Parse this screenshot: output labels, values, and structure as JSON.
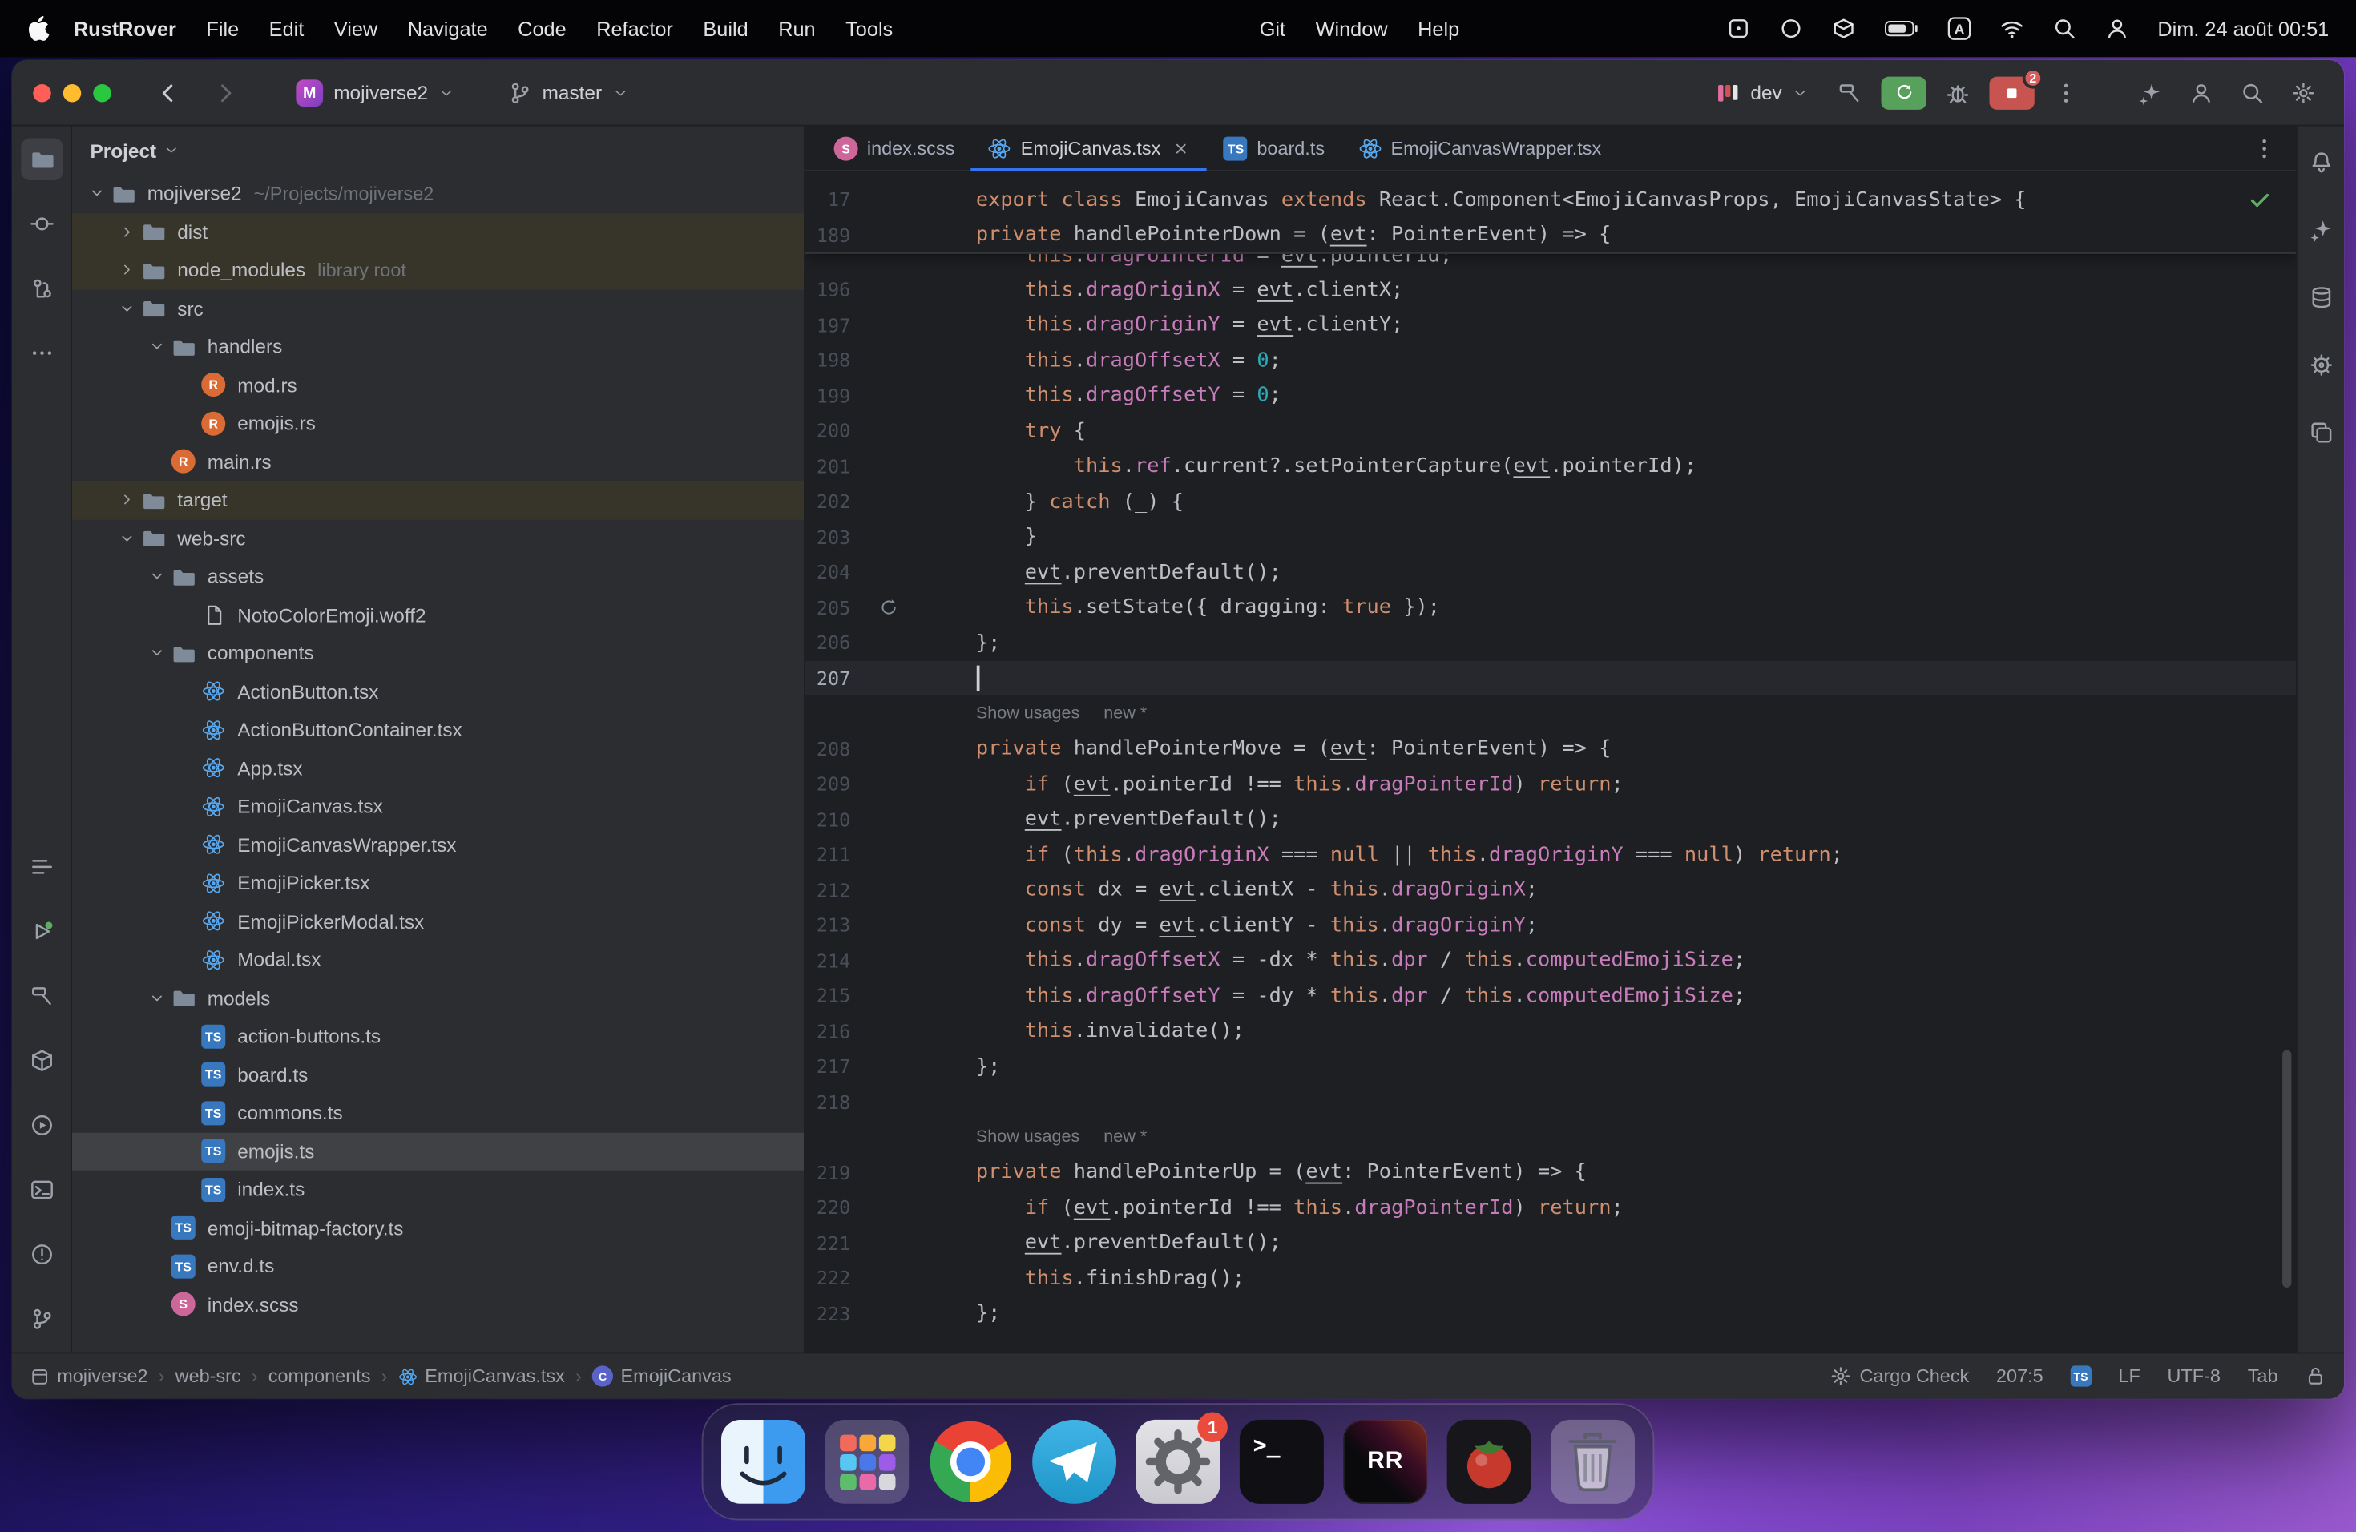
{
  "colors": {
    "accent": "#3574F0",
    "keyword": "#CF8E6D",
    "field": "#C77DBB",
    "number": "#2AACB8",
    "text": "#BCBEC4",
    "excluded_bg": "#37352A",
    "run_green": "#57A15D",
    "stop_red": "#C75450"
  },
  "menubar": {
    "menus": [
      "RustRover",
      "File",
      "Edit",
      "View",
      "Navigate",
      "Code",
      "Refactor",
      "Build",
      "Run",
      "Tools"
    ],
    "menus2": [
      "Git",
      "Window",
      "Help"
    ],
    "status_icons": [
      "screen-box",
      "recording",
      "dropbox",
      "battery",
      "input-source",
      "wifi",
      "spotlight",
      "user-switch"
    ],
    "input_source": "A",
    "clock": "Dim. 24 août 00:51"
  },
  "titlebar": {
    "project_name": "mojiverse2",
    "project_initial": "M",
    "branch": "master",
    "run_config": "dev",
    "stop_badge": "2"
  },
  "left_strip": {
    "top": [
      "project",
      "commit",
      "pull-requests",
      "more"
    ],
    "bottom": [
      "structure",
      "run",
      "build",
      "packages",
      "services",
      "terminal",
      "problems",
      "version-control"
    ]
  },
  "right_strip": [
    "notifications",
    "ai-assistant",
    "database",
    "cargo",
    "dependencies"
  ],
  "project_panel": {
    "header": "Project",
    "tree": [
      {
        "l": "mojiverse2",
        "s": "~/Projects/mojiverse2",
        "i": "folder",
        "d": 0,
        "c": "open"
      },
      {
        "l": "dist",
        "i": "folder",
        "d": 1,
        "c": "closed",
        "m": "excluded"
      },
      {
        "l": "node_modules",
        "s": "library root",
        "i": "folder",
        "d": 1,
        "c": "closed",
        "m": "excluded"
      },
      {
        "l": "src",
        "i": "folder",
        "d": 1,
        "c": "open"
      },
      {
        "l": "handlers",
        "i": "folder",
        "d": 2,
        "c": "open"
      },
      {
        "l": "mod.rs",
        "i": "rust",
        "d": 3
      },
      {
        "l": "emojis.rs",
        "i": "rust",
        "d": 3
      },
      {
        "l": "main.rs",
        "i": "rust",
        "d": 2
      },
      {
        "l": "target",
        "i": "folder",
        "d": 1,
        "c": "closed",
        "m": "excluded"
      },
      {
        "l": "web-src",
        "i": "folder",
        "d": 1,
        "c": "open"
      },
      {
        "l": "assets",
        "i": "folder",
        "d": 2,
        "c": "open"
      },
      {
        "l": "NotoColorEmoji.woff2",
        "i": "file",
        "d": 3
      },
      {
        "l": "components",
        "i": "folder",
        "d": 2,
        "c": "open"
      },
      {
        "l": "ActionButton.tsx",
        "i": "react",
        "d": 3
      },
      {
        "l": "ActionButtonContainer.tsx",
        "i": "react",
        "d": 3
      },
      {
        "l": "App.tsx",
        "i": "react",
        "d": 3
      },
      {
        "l": "EmojiCanvas.tsx",
        "i": "react",
        "d": 3
      },
      {
        "l": "EmojiCanvasWrapper.tsx",
        "i": "react",
        "d": 3
      },
      {
        "l": "EmojiPicker.tsx",
        "i": "react",
        "d": 3
      },
      {
        "l": "EmojiPickerModal.tsx",
        "i": "react",
        "d": 3
      },
      {
        "l": "Modal.tsx",
        "i": "react",
        "d": 3
      },
      {
        "l": "models",
        "i": "folder",
        "d": 2,
        "c": "open"
      },
      {
        "l": "action-buttons.ts",
        "i": "ts",
        "d": 3
      },
      {
        "l": "board.ts",
        "i": "ts",
        "d": 3
      },
      {
        "l": "commons.ts",
        "i": "ts",
        "d": 3
      },
      {
        "l": "emojis.ts",
        "i": "ts",
        "d": 3,
        "m": "selected"
      },
      {
        "l": "index.ts",
        "i": "ts",
        "d": 3
      },
      {
        "l": "emoji-bitmap-factory.ts",
        "i": "ts",
        "d": 2
      },
      {
        "l": "env.d.ts",
        "i": "ts",
        "d": 2
      },
      {
        "l": "index.scss",
        "i": "scss",
        "d": 2
      }
    ]
  },
  "tabs": [
    {
      "label": "index.scss",
      "icon": "scss"
    },
    {
      "label": "EmojiCanvas.tsx",
      "icon": "react",
      "active": true,
      "close": true
    },
    {
      "label": "board.ts",
      "icon": "ts"
    },
    {
      "label": "EmojiCanvasWrapper.tsx",
      "icon": "react"
    }
  ],
  "editor": {
    "hints": {
      "usages": "Show usages",
      "new": "new *"
    },
    "sticky_lines": [
      {
        "n": "17",
        "ind": 0,
        "parts": [
          [
            "export ",
            "k"
          ],
          [
            "class ",
            "k"
          ],
          [
            "EmojiCanvas ",
            "d"
          ],
          [
            "extends ",
            "k"
          ],
          [
            "React.Component<EmojiCanvasProps, EmojiCanvasState> {",
            "d"
          ]
        ]
      },
      {
        "n": "189",
        "ind": 4,
        "parts": [
          [
            "private ",
            "k"
          ],
          [
            "handlePointerDown = (",
            "d"
          ],
          [
            "evt",
            "u"
          ],
          [
            ": PointerEvent) => {",
            "d"
          ]
        ]
      }
    ],
    "lines": [
      {
        "clip": true,
        "ind": 8,
        "parts": [
          [
            "this",
            "k"
          ],
          [
            ".",
            "d"
          ],
          [
            "dragPointerId",
            "f"
          ],
          [
            " = ",
            "d"
          ],
          [
            "evt",
            "u"
          ],
          [
            ".pointerId;",
            "d"
          ]
        ]
      },
      {
        "n": "196",
        "ind": 8,
        "parts": [
          [
            "this",
            "k"
          ],
          [
            ".",
            "d"
          ],
          [
            "dragOriginX",
            "f"
          ],
          [
            " = ",
            "d"
          ],
          [
            "evt",
            "u"
          ],
          [
            ".clientX;",
            "d"
          ]
        ]
      },
      {
        "n": "197",
        "ind": 8,
        "parts": [
          [
            "this",
            "k"
          ],
          [
            ".",
            "d"
          ],
          [
            "dragOriginY",
            "f"
          ],
          [
            " = ",
            "d"
          ],
          [
            "evt",
            "u"
          ],
          [
            ".clientY;",
            "d"
          ]
        ]
      },
      {
        "n": "198",
        "ind": 8,
        "parts": [
          [
            "this",
            "k"
          ],
          [
            ".",
            "d"
          ],
          [
            "dragOffsetX",
            "f"
          ],
          [
            " = ",
            "d"
          ],
          [
            "0",
            "n"
          ],
          [
            ";",
            "d"
          ]
        ]
      },
      {
        "n": "199",
        "ind": 8,
        "parts": [
          [
            "this",
            "k"
          ],
          [
            ".",
            "d"
          ],
          [
            "dragOffsetY",
            "f"
          ],
          [
            " = ",
            "d"
          ],
          [
            "0",
            "n"
          ],
          [
            ";",
            "d"
          ]
        ]
      },
      {
        "n": "200",
        "ind": 8,
        "parts": [
          [
            "try",
            "k"
          ],
          [
            " {",
            "d"
          ]
        ]
      },
      {
        "n": "201",
        "ind": 12,
        "parts": [
          [
            "this",
            "k"
          ],
          [
            ".",
            "d"
          ],
          [
            "ref",
            "f"
          ],
          [
            ".current?.setPointerCapture(",
            "d"
          ],
          [
            "evt",
            "u"
          ],
          [
            ".pointerId);",
            "d"
          ]
        ]
      },
      {
        "n": "202",
        "ind": 8,
        "parts": [
          [
            "} ",
            "d"
          ],
          [
            "catch",
            "k"
          ],
          [
            " (_) {",
            "d"
          ]
        ]
      },
      {
        "n": "203",
        "ind": 8,
        "parts": [
          [
            "}",
            "d"
          ]
        ]
      },
      {
        "n": "204",
        "ind": 8,
        "parts": [
          [
            "evt",
            "u"
          ],
          [
            ".preventDefault();",
            "d"
          ]
        ]
      },
      {
        "n": "205",
        "ind": 8,
        "gutter_icon": "recompile",
        "parts": [
          [
            "this",
            "k"
          ],
          [
            ".setState({ dragging: ",
            "d"
          ],
          [
            "true",
            "k"
          ],
          [
            " });",
            "d"
          ]
        ]
      },
      {
        "n": "206",
        "ind": 4,
        "parts": [
          [
            "};",
            "d"
          ]
        ]
      },
      {
        "n": "207",
        "ind": 4,
        "caret": true,
        "parts": []
      },
      {
        "hint": true
      },
      {
        "n": "208",
        "ind": 4,
        "parts": [
          [
            "private ",
            "k"
          ],
          [
            "handlePointerMove = (",
            "d"
          ],
          [
            "evt",
            "u"
          ],
          [
            ": PointerEvent) => {",
            "d"
          ]
        ]
      },
      {
        "n": "209",
        "ind": 8,
        "parts": [
          [
            "if",
            "k"
          ],
          [
            " (",
            "d"
          ],
          [
            "evt",
            "u"
          ],
          [
            ".pointerId !== ",
            "d"
          ],
          [
            "this",
            "k"
          ],
          [
            ".",
            "d"
          ],
          [
            "dragPointerId",
            "f"
          ],
          [
            ") ",
            "d"
          ],
          [
            "return",
            "k"
          ],
          [
            ";",
            "d"
          ]
        ]
      },
      {
        "n": "210",
        "ind": 8,
        "parts": [
          [
            "evt",
            "u"
          ],
          [
            ".preventDefault();",
            "d"
          ]
        ]
      },
      {
        "n": "211",
        "ind": 8,
        "parts": [
          [
            "if",
            "k"
          ],
          [
            " (",
            "d"
          ],
          [
            "this",
            "k"
          ],
          [
            ".",
            "d"
          ],
          [
            "dragOriginX",
            "f"
          ],
          [
            " === ",
            "d"
          ],
          [
            "null",
            "k"
          ],
          [
            " || ",
            "d"
          ],
          [
            "this",
            "k"
          ],
          [
            ".",
            "d"
          ],
          [
            "dragOriginY",
            "f"
          ],
          [
            " === ",
            "d"
          ],
          [
            "null",
            "k"
          ],
          [
            ") ",
            "d"
          ],
          [
            "return",
            "k"
          ],
          [
            ";",
            "d"
          ]
        ]
      },
      {
        "n": "212",
        "ind": 8,
        "parts": [
          [
            "const",
            "k"
          ],
          [
            " dx = ",
            "d"
          ],
          [
            "evt",
            "u"
          ],
          [
            ".clientX - ",
            "d"
          ],
          [
            "this",
            "k"
          ],
          [
            ".",
            "d"
          ],
          [
            "dragOriginX",
            "f"
          ],
          [
            ";",
            "d"
          ]
        ]
      },
      {
        "n": "213",
        "ind": 8,
        "parts": [
          [
            "const",
            "k"
          ],
          [
            " dy = ",
            "d"
          ],
          [
            "evt",
            "u"
          ],
          [
            ".clientY - ",
            "d"
          ],
          [
            "this",
            "k"
          ],
          [
            ".",
            "d"
          ],
          [
            "dragOriginY",
            "f"
          ],
          [
            ";",
            "d"
          ]
        ]
      },
      {
        "n": "214",
        "ind": 8,
        "parts": [
          [
            "this",
            "k"
          ],
          [
            ".",
            "d"
          ],
          [
            "dragOffsetX",
            "f"
          ],
          [
            " = -dx * ",
            "d"
          ],
          [
            "this",
            "k"
          ],
          [
            ".",
            "d"
          ],
          [
            "dpr",
            "f"
          ],
          [
            " / ",
            "d"
          ],
          [
            "this",
            "k"
          ],
          [
            ".",
            "d"
          ],
          [
            "computedEmojiSize",
            "f"
          ],
          [
            ";",
            "d"
          ]
        ]
      },
      {
        "n": "215",
        "ind": 8,
        "parts": [
          [
            "this",
            "k"
          ],
          [
            ".",
            "d"
          ],
          [
            "dragOffsetY",
            "f"
          ],
          [
            " = -dy * ",
            "d"
          ],
          [
            "this",
            "k"
          ],
          [
            ".",
            "d"
          ],
          [
            "dpr",
            "f"
          ],
          [
            " / ",
            "d"
          ],
          [
            "this",
            "k"
          ],
          [
            ".",
            "d"
          ],
          [
            "computedEmojiSize",
            "f"
          ],
          [
            ";",
            "d"
          ]
        ]
      },
      {
        "n": "216",
        "ind": 8,
        "parts": [
          [
            "this",
            "k"
          ],
          [
            ".invalidate();",
            "d"
          ]
        ]
      },
      {
        "n": "217",
        "ind": 4,
        "parts": [
          [
            "};",
            "d"
          ]
        ]
      },
      {
        "n": "218",
        "ind": 0,
        "parts": []
      },
      {
        "hint": true
      },
      {
        "n": "219",
        "ind": 4,
        "parts": [
          [
            "private ",
            "k"
          ],
          [
            "handlePointerUp = (",
            "d"
          ],
          [
            "evt",
            "u"
          ],
          [
            ": PointerEvent) => {",
            "d"
          ]
        ]
      },
      {
        "n": "220",
        "ind": 8,
        "parts": [
          [
            "if",
            "k"
          ],
          [
            " (",
            "d"
          ],
          [
            "evt",
            "u"
          ],
          [
            ".pointerId !== ",
            "d"
          ],
          [
            "this",
            "k"
          ],
          [
            ".",
            "d"
          ],
          [
            "dragPointerId",
            "f"
          ],
          [
            ") ",
            "d"
          ],
          [
            "return",
            "k"
          ],
          [
            ";",
            "d"
          ]
        ]
      },
      {
        "n": "221",
        "ind": 8,
        "parts": [
          [
            "evt",
            "u"
          ],
          [
            ".preventDefault();",
            "d"
          ]
        ]
      },
      {
        "n": "222",
        "ind": 8,
        "parts": [
          [
            "this",
            "k"
          ],
          [
            ".finishDrag();",
            "d"
          ]
        ]
      },
      {
        "n": "223",
        "ind": 4,
        "parts": [
          [
            "};",
            "d"
          ]
        ]
      }
    ]
  },
  "statusbar": {
    "breadcrumbs": [
      {
        "icon": "window",
        "label": "mojiverse2"
      },
      {
        "label": "web-src"
      },
      {
        "label": "components"
      },
      {
        "icon": "react",
        "label": "EmojiCanvas.tsx"
      },
      {
        "icon": "class",
        "label": "EmojiCanvas"
      }
    ],
    "cargo_check": "Cargo Check",
    "caret_position": "207:5",
    "ts_badge": "TS",
    "line_ending": "LF",
    "encoding": "UTF-8",
    "indent": "Tab"
  },
  "dock": {
    "items": [
      {
        "id": "finder"
      },
      {
        "id": "launchpad"
      },
      {
        "id": "chrome"
      },
      {
        "id": "telegram"
      },
      {
        "id": "settings",
        "badge": "1"
      },
      {
        "id": "terminal",
        "glyph": ">_"
      },
      {
        "id": "rustrover",
        "glyph": "RR"
      },
      {
        "id": "photo"
      },
      {
        "id": "trash"
      }
    ]
  }
}
